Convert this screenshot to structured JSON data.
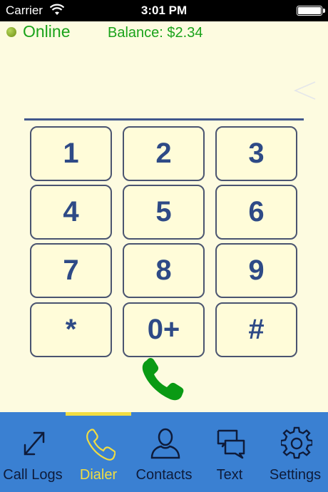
{
  "status_bar": {
    "carrier": "Carrier",
    "time": "3:01 PM"
  },
  "account": {
    "status": "Online",
    "balance": "Balance: $2.34"
  },
  "keypad": {
    "keys": [
      "1",
      "2",
      "3",
      "4",
      "5",
      "6",
      "7",
      "8",
      "9",
      "*",
      "0+",
      "#"
    ]
  },
  "tabs": [
    {
      "label": "Call Logs",
      "icon": "call-logs-icon"
    },
    {
      "label": "Dialer",
      "icon": "dialer-icon",
      "active": true
    },
    {
      "label": "Contacts",
      "icon": "contacts-icon"
    },
    {
      "label": "Text",
      "icon": "text-icon"
    },
    {
      "label": "Settings",
      "icon": "settings-icon"
    }
  ],
  "colors": {
    "background": "#fdfbe0",
    "accent_green": "#1aa31a",
    "key_text": "#2e4a86",
    "tab_bar": "#3a80d2",
    "tab_active": "#f1dd42"
  }
}
